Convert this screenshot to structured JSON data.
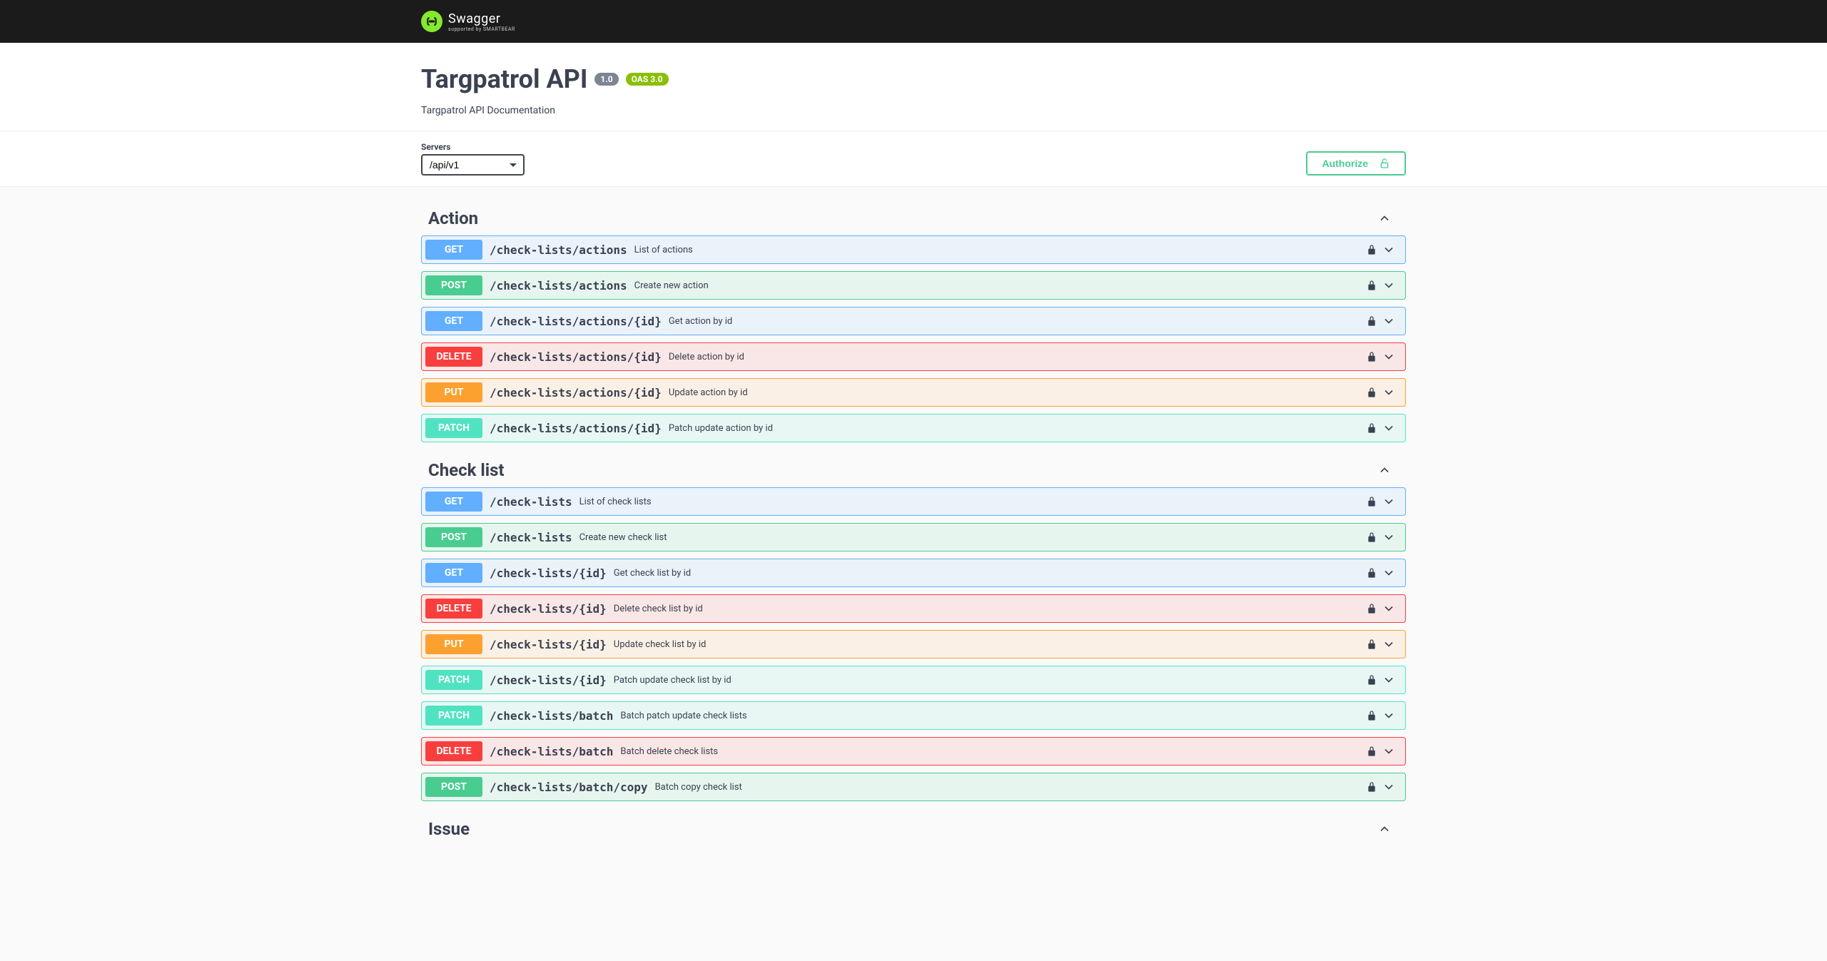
{
  "brand": "Swagger",
  "brand_sub": "supported by SMARTBEAR",
  "title": "Targpatrol API",
  "version": "1.0",
  "oas": "OAS 3.0",
  "description": "Targpatrol API Documentation",
  "servers_label": "Servers",
  "servers_value": "/api/v1",
  "authorize": "Authorize",
  "tags": [
    {
      "name": "Action",
      "ops": [
        {
          "method": "GET",
          "path": "/check-lists/actions",
          "desc": "List of actions"
        },
        {
          "method": "POST",
          "path": "/check-lists/actions",
          "desc": "Create new action"
        },
        {
          "method": "GET",
          "path": "/check-lists/actions/{id}",
          "desc": "Get action by id"
        },
        {
          "method": "DELETE",
          "path": "/check-lists/actions/{id}",
          "desc": "Delete action by id"
        },
        {
          "method": "PUT",
          "path": "/check-lists/actions/{id}",
          "desc": "Update action by id"
        },
        {
          "method": "PATCH",
          "path": "/check-lists/actions/{id}",
          "desc": "Patch update action by id"
        }
      ]
    },
    {
      "name": "Check list",
      "ops": [
        {
          "method": "GET",
          "path": "/check-lists",
          "desc": "List of check lists"
        },
        {
          "method": "POST",
          "path": "/check-lists",
          "desc": "Create new check list"
        },
        {
          "method": "GET",
          "path": "/check-lists/{id}",
          "desc": "Get check list by id"
        },
        {
          "method": "DELETE",
          "path": "/check-lists/{id}",
          "desc": "Delete check list by id"
        },
        {
          "method": "PUT",
          "path": "/check-lists/{id}",
          "desc": "Update check list by id"
        },
        {
          "method": "PATCH",
          "path": "/check-lists/{id}",
          "desc": "Patch update check list by id"
        },
        {
          "method": "PATCH",
          "path": "/check-lists/batch",
          "desc": "Batch patch update check lists"
        },
        {
          "method": "DELETE",
          "path": "/check-lists/batch",
          "desc": "Batch delete check lists"
        },
        {
          "method": "POST",
          "path": "/check-lists/batch/copy",
          "desc": "Batch copy check list"
        }
      ]
    },
    {
      "name": "Issue",
      "ops": []
    }
  ]
}
